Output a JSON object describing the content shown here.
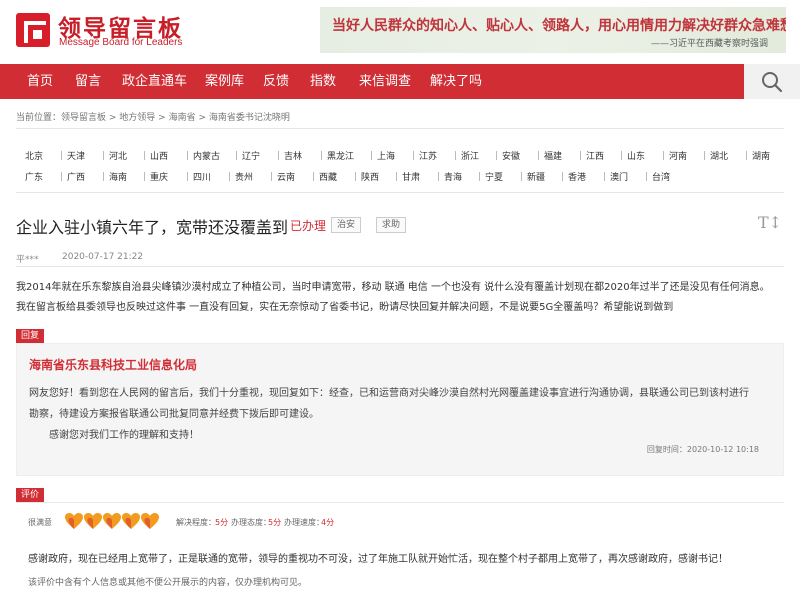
{
  "header": {
    "logo_cn": "领导留言板",
    "logo_en": "Message Board for Leaders",
    "banner_quote": "当好人民群众的知心人、贴心人、领路人，用心用情用力解决好群众急难愁盼问题。",
    "banner_sign": "——习近平在西藏考察时强调"
  },
  "nav": {
    "items": [
      "首页",
      "留言",
      "政企直通车",
      "案例库",
      "反馈",
      "指数",
      "来信调查",
      "解决了吗"
    ],
    "search_icon": "search-icon"
  },
  "breadcrumb": {
    "prefix": "当前位置：",
    "items": [
      "领导留言板",
      "地方领导",
      "海南省",
      "海南省委书记沈晓明"
    ],
    "separator": " > "
  },
  "regions": {
    "row1": [
      "北京",
      "天津",
      "河北",
      "山西",
      "内蒙古",
      "辽宁",
      "吉林",
      "黑龙江",
      "上海",
      "江苏",
      "浙江",
      "安徽",
      "福建",
      "江西",
      "山东",
      "河南",
      "湖北",
      "湖南"
    ],
    "row2": [
      "广东",
      "广西",
      "海南",
      "重庆",
      "四川",
      "贵州",
      "云南",
      "西藏",
      "陕西",
      "甘肃",
      "青海",
      "宁夏",
      "新疆",
      "香港",
      "澳门",
      "台湾"
    ]
  },
  "message": {
    "title": "企业入驻小镇六年了，宽带还没覆盖到",
    "status": "已办理",
    "tags": [
      "治安",
      "求助"
    ],
    "font_toggle": "T↕",
    "author": "平***",
    "date": "2020-07-17 21:22",
    "body_line1": "我2014年就在乐东黎族自治县尖峰镇沙漠村成立了种植公司，当时申请宽带，移动 联通 电信 一个也没有 说什么没有覆盖计划现在都2020年过半了还是没见有任何消息。",
    "body_line2": "我在留言板给县委领导也反映过这件事 一直没有回复，实在无奈惊动了省委书记，盼请尽快回复并解决问题，不是说要5G全覆盖吗？希望能说到做到"
  },
  "reply": {
    "label": "回复",
    "org": "海南省乐东县科技工业信息化局",
    "line1": "网友您好！看到您在人民网的留言后，我们十分重视，现回复如下：经查，已和运营商对尖峰沙漠自然村光网覆盖建设事宜进行沟通协调，县联通公司已到该村进行",
    "line2": "勘察，待建设方案报省联通公司批复同意并经费下拨后即可建设。",
    "line3": "感谢您对我们工作的理解和支持！",
    "time": "回复时间：2020-10-12 10:18"
  },
  "evaluation": {
    "label": "评价",
    "overall_label": "很满意",
    "hearts_filled": 5,
    "hearts_total": 5,
    "heart_color": "#f39b1f",
    "heart_accent": "#d12d35",
    "scores": [
      {
        "label": "解决程度：",
        "value": "5分"
      },
      {
        "label": "办理态度：",
        "value": "5分"
      },
      {
        "label": "办理速度：",
        "value": "4分"
      }
    ],
    "text": "感谢政府，现在已经用上宽带了，正是联通的宽带，领导的重视功不可没，过了年施工队就开始忙活，现在整个村子都用上宽带了，再次感谢政府，感谢书记！",
    "note": "该评价中含有个人信息或其他不便公开展示的内容，仅办理机构可见。"
  },
  "colors": {
    "brand_red": "#d12d35",
    "reply_bg": "#f5f5f5"
  }
}
